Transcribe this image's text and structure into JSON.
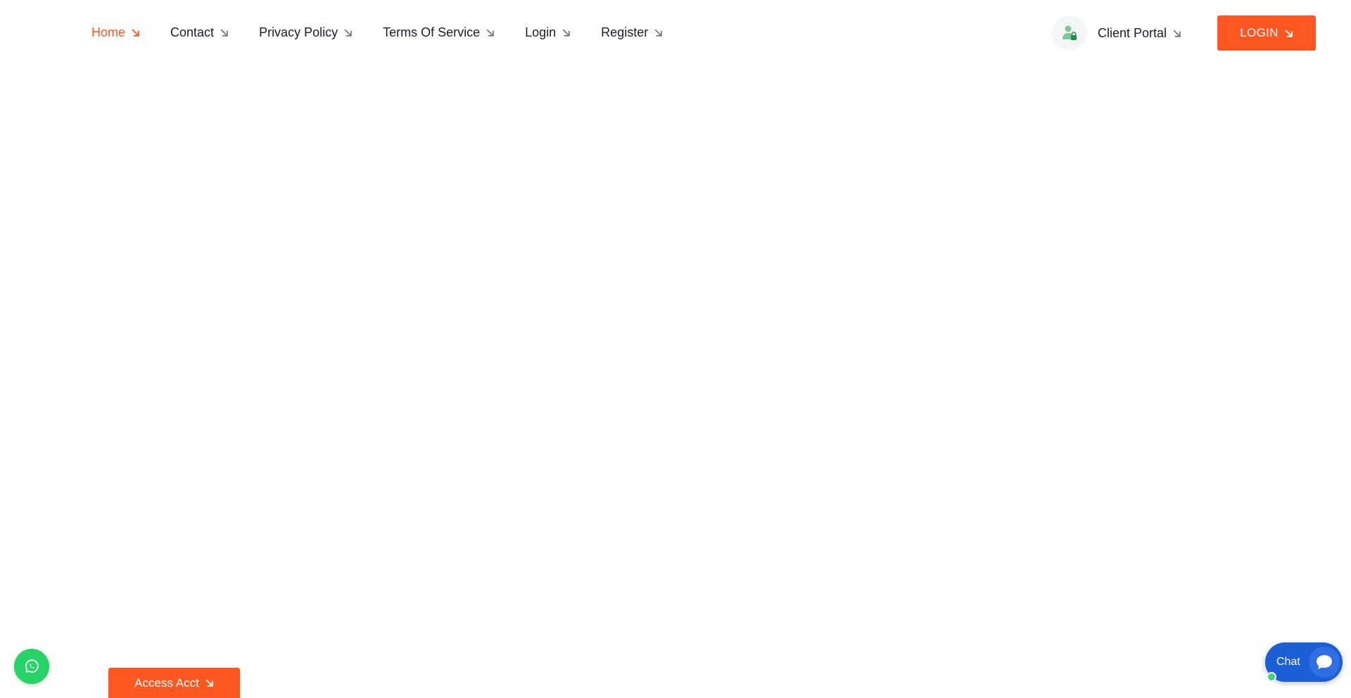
{
  "nav": {
    "items": [
      {
        "label": "Home",
        "active": true
      },
      {
        "label": "Contact",
        "active": false
      },
      {
        "label": "Privacy Policy",
        "active": false
      },
      {
        "label": "Terms Of Service",
        "active": false
      },
      {
        "label": "Login",
        "active": false
      },
      {
        "label": "Register",
        "active": false
      }
    ]
  },
  "portal": {
    "label": "Client Portal",
    "icon": "user-lock-icon"
  },
  "login_button": {
    "label": "LOGIN"
  },
  "access_button": {
    "label": "Access Acct"
  },
  "chat": {
    "label": "Chat",
    "icon": "chat-bubble-icon"
  },
  "whatsapp": {
    "icon": "whatsapp-icon"
  },
  "colors": {
    "accent": "#ff5722",
    "whatsapp": "#25d366",
    "chat": "#1a5fd6",
    "text": "#1c1c2b"
  }
}
